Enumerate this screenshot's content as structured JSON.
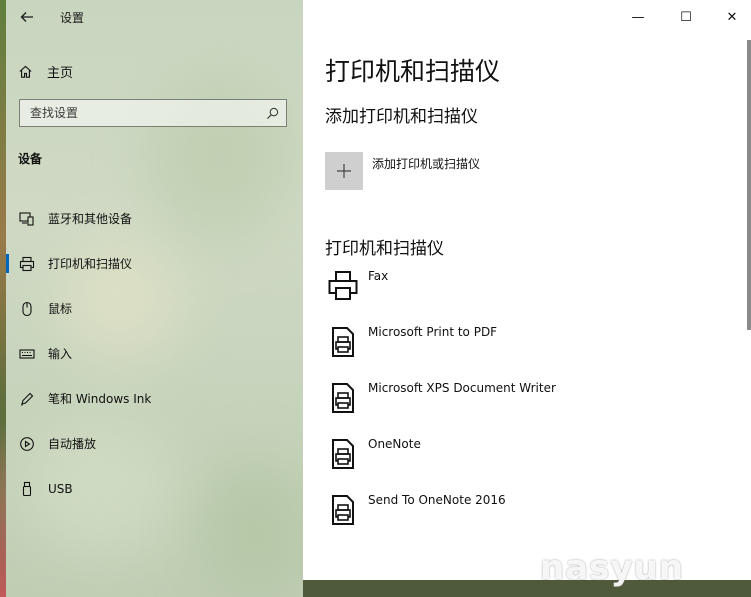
{
  "window": {
    "app_title": "设置",
    "controls": {
      "minimize": "—",
      "maximize": "☐",
      "close": "✕"
    }
  },
  "sidebar": {
    "home_label": "主页",
    "search_placeholder": "查找设置",
    "section_label": "设备",
    "items": [
      {
        "label": "蓝牙和其他设备",
        "icon": "bluetooth-devices-icon",
        "active": false
      },
      {
        "label": "打印机和扫描仪",
        "icon": "printer-icon",
        "active": true
      },
      {
        "label": "鼠标",
        "icon": "mouse-icon",
        "active": false
      },
      {
        "label": "输入",
        "icon": "keyboard-icon",
        "active": false
      },
      {
        "label": "笔和 Windows Ink",
        "icon": "pen-icon",
        "active": false
      },
      {
        "label": "自动播放",
        "icon": "autoplay-icon",
        "active": false
      },
      {
        "label": "USB",
        "icon": "usb-icon",
        "active": false
      }
    ]
  },
  "main": {
    "title": "打印机和扫描仪",
    "add_section_title": "添加打印机和扫描仪",
    "add_button_label": "添加打印机或扫描仪",
    "printers_section_title": "打印机和扫描仪",
    "printers": [
      {
        "name": "Fax",
        "icon": "fax-printer-icon"
      },
      {
        "name": "Microsoft Print to PDF",
        "icon": "document-printer-icon"
      },
      {
        "name": "Microsoft XPS Document Writer",
        "icon": "document-printer-icon"
      },
      {
        "name": "OneNote",
        "icon": "document-printer-icon"
      },
      {
        "name": "Send To OneNote 2016",
        "icon": "document-printer-icon"
      }
    ]
  },
  "watermark": "nasyun",
  "colors": {
    "accent": "#0067c0",
    "add_tile": "#cfcfcf"
  }
}
